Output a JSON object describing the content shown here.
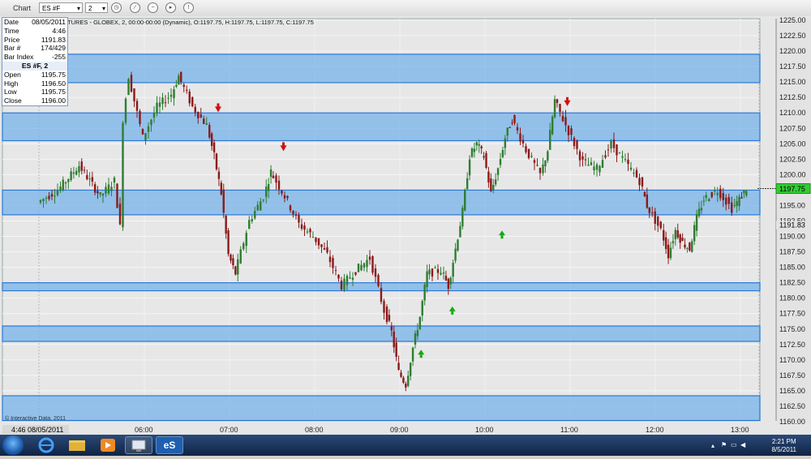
{
  "toolbar": {
    "title": "Chart",
    "symbol": "ES #F",
    "interval": "2",
    "buttons": [
      "clock-icon",
      "draw-icon",
      "minus-icon",
      "play-icon",
      "alert-icon"
    ]
  },
  "chart_header": "TURES - GLOBEX, 2, 00:00-00:00 (Dynamic), O:1197.75, H:1197.75, L:1197.75, C:1197.75",
  "info": {
    "rows": [
      {
        "k": "Date",
        "v": "08/05/2011"
      },
      {
        "k": "Time",
        "v": "4:46"
      },
      {
        "k": "Price",
        "v": "1191.83"
      },
      {
        "k": "Bar #",
        "v": "174/429"
      },
      {
        "k": "Bar Index",
        "v": "-255"
      }
    ],
    "symbol_title": "ES #F, 2",
    "ohlc": [
      {
        "k": "Open",
        "v": "1195.75"
      },
      {
        "k": "High",
        "v": "1196.50"
      },
      {
        "k": "Low",
        "v": "1195.75"
      },
      {
        "k": "Close",
        "v": "1196.00"
      }
    ]
  },
  "cursor_time": "4:46 08/05/2011",
  "watermark": "© Interactive Data, 2011",
  "colors": {
    "up": "#2e7d32",
    "down": "#8b1a1a",
    "zone_fill": "#77b3e8",
    "zone_edge": "#2a78d8",
    "last_price": "#33cc33",
    "cursor_label": "#ffff99"
  },
  "chart_data": {
    "type": "candlestick",
    "y_ticks": [
      "1225.00",
      "1222.50",
      "1220.00",
      "1217.50",
      "1215.00",
      "1212.50",
      "1210.00",
      "1207.50",
      "1205.00",
      "1202.50",
      "1200.00",
      "1197.50",
      "1195.00",
      "1192.50",
      "1190.00",
      "1187.50",
      "1185.00",
      "1182.50",
      "1180.00",
      "1177.50",
      "1175.00",
      "1172.50",
      "1170.00",
      "1167.50",
      "1165.00",
      "1162.50",
      "1160.00"
    ],
    "ylim": [
      1160,
      1226
    ],
    "x_ticks": [
      "06:00",
      "07:00",
      "08:00",
      "09:00",
      "10:00",
      "11:00",
      "12:00",
      "13:00"
    ],
    "last_price": "1197.75",
    "cursor_price": "1191.83",
    "zones": [
      [
        1214.9,
        1219.5
      ],
      [
        1205.5,
        1210.0
      ],
      [
        1193.5,
        1197.5
      ],
      [
        1181.2,
        1182.5
      ],
      [
        1173.0,
        1175.5
      ],
      [
        1160.2,
        1164.2
      ]
    ],
    "arrows": [
      {
        "t": "06:52",
        "p": 1210.5,
        "dir": "down"
      },
      {
        "t": "07:38",
        "p": 1204.2,
        "dir": "down"
      },
      {
        "t": "09:15",
        "p": 1171.0,
        "dir": "up"
      },
      {
        "t": "09:37",
        "p": 1178.0,
        "dir": "up"
      },
      {
        "t": "10:12",
        "p": 1190.3,
        "dir": "up"
      },
      {
        "t": "10:58",
        "p": 1211.5,
        "dir": "down"
      }
    ],
    "series": [
      {
        "t": "04:46",
        "p": 1195.5
      },
      {
        "t": "05:00",
        "p": 1197.5
      },
      {
        "t": "05:15",
        "p": 1201.5
      },
      {
        "t": "05:30",
        "p": 1196.5
      },
      {
        "t": "05:40",
        "p": 1199.0
      },
      {
        "t": "05:44",
        "p": 1191.5
      },
      {
        "t": "05:46",
        "p": 1209.0
      },
      {
        "t": "05:50",
        "p": 1216.0
      },
      {
        "t": "06:00",
        "p": 1206.0
      },
      {
        "t": "06:10",
        "p": 1211.0
      },
      {
        "t": "06:20",
        "p": 1213.0
      },
      {
        "t": "06:25",
        "p": 1216.0
      },
      {
        "t": "06:35",
        "p": 1211.0
      },
      {
        "t": "06:45",
        "p": 1208.0
      },
      {
        "t": "06:50",
        "p": 1203.0
      },
      {
        "t": "06:55",
        "p": 1197.0
      },
      {
        "t": "07:00",
        "p": 1187.0
      },
      {
        "t": "07:05",
        "p": 1184.0
      },
      {
        "t": "07:15",
        "p": 1192.5
      },
      {
        "t": "07:25",
        "p": 1196.5
      },
      {
        "t": "07:30",
        "p": 1200.5
      },
      {
        "t": "07:40",
        "p": 1196.5
      },
      {
        "t": "07:50",
        "p": 1192.0
      },
      {
        "t": "08:00",
        "p": 1190.0
      },
      {
        "t": "08:10",
        "p": 1187.0
      },
      {
        "t": "08:20",
        "p": 1182.0
      },
      {
        "t": "08:30",
        "p": 1184.5
      },
      {
        "t": "08:40",
        "p": 1186.5
      },
      {
        "t": "08:50",
        "p": 1178.0
      },
      {
        "t": "08:55",
        "p": 1174.5
      },
      {
        "t": "09:00",
        "p": 1168.0
      },
      {
        "t": "09:05",
        "p": 1166.0
      },
      {
        "t": "09:10",
        "p": 1172.0
      },
      {
        "t": "09:15",
        "p": 1177.0
      },
      {
        "t": "09:20",
        "p": 1184.0
      },
      {
        "t": "09:30",
        "p": 1184.5
      },
      {
        "t": "09:35",
        "p": 1182.0
      },
      {
        "t": "09:40",
        "p": 1188.0
      },
      {
        "t": "09:45",
        "p": 1194.0
      },
      {
        "t": "09:50",
        "p": 1203.0
      },
      {
        "t": "09:55",
        "p": 1205.0
      },
      {
        "t": "10:00",
        "p": 1203.0
      },
      {
        "t": "10:05",
        "p": 1197.0
      },
      {
        "t": "10:10",
        "p": 1201.0
      },
      {
        "t": "10:15",
        "p": 1206.0
      },
      {
        "t": "10:20",
        "p": 1209.0
      },
      {
        "t": "10:30",
        "p": 1204.0
      },
      {
        "t": "10:40",
        "p": 1200.0
      },
      {
        "t": "10:45",
        "p": 1204.0
      },
      {
        "t": "10:50",
        "p": 1212.0
      },
      {
        "t": "11:00",
        "p": 1207.0
      },
      {
        "t": "11:10",
        "p": 1202.0
      },
      {
        "t": "11:20",
        "p": 1201.0
      },
      {
        "t": "11:30",
        "p": 1205.0
      },
      {
        "t": "11:40",
        "p": 1202.0
      },
      {
        "t": "11:50",
        "p": 1199.0
      },
      {
        "t": "11:55",
        "p": 1195.0
      },
      {
        "t": "12:05",
        "p": 1191.0
      },
      {
        "t": "12:10",
        "p": 1187.0
      },
      {
        "t": "12:15",
        "p": 1191.0
      },
      {
        "t": "12:20",
        "p": 1189.0
      },
      {
        "t": "12:25",
        "p": 1188.0
      },
      {
        "t": "12:30",
        "p": 1193.0
      },
      {
        "t": "12:35",
        "p": 1196.0
      },
      {
        "t": "12:45",
        "p": 1197.5
      },
      {
        "t": "12:55",
        "p": 1194.5
      },
      {
        "t": "13:00",
        "p": 1196.0
      },
      {
        "t": "13:05",
        "p": 1197.75
      }
    ]
  },
  "taskbar": {
    "apps": [
      "internet-explorer-icon",
      "file-explorer-icon",
      "media-player-icon",
      "network-icon",
      "esignal-icon"
    ],
    "esignal_label": "eS",
    "time": "2:21 PM",
    "date": "8/5/2011"
  }
}
